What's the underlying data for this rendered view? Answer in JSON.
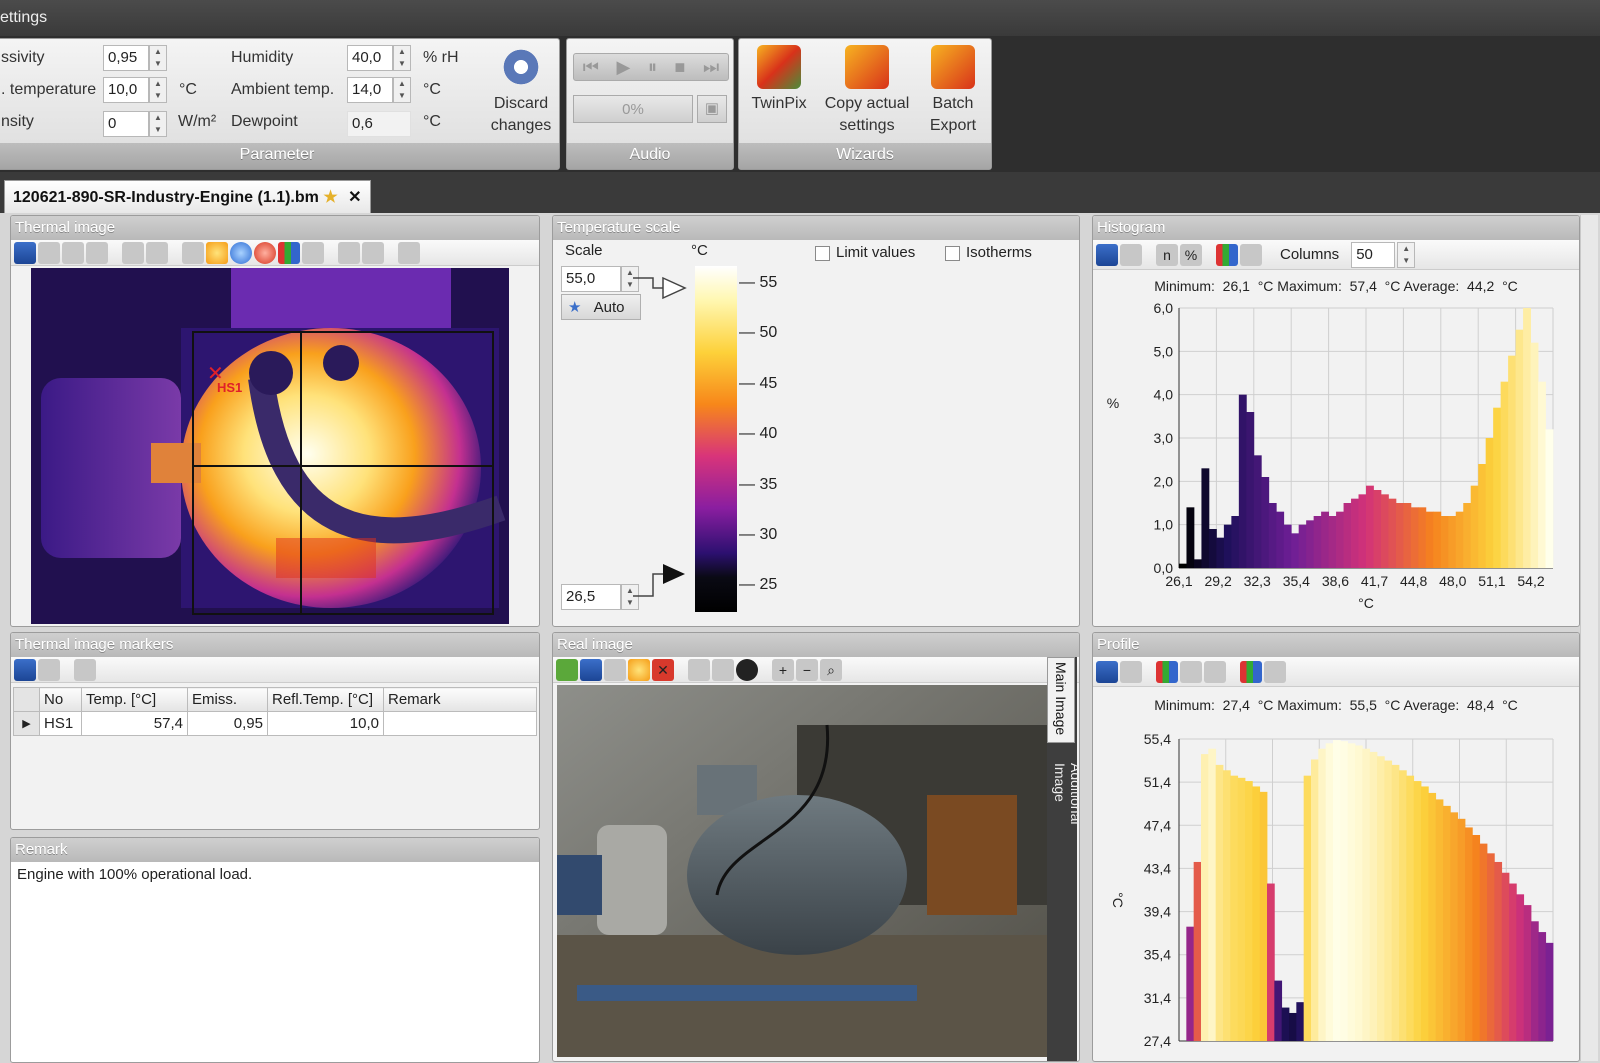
{
  "window": {
    "title": "ettings"
  },
  "ribbon": {
    "parameter": {
      "title": "Parameter",
      "rows": [
        {
          "label": "ssivity",
          "value": "0,95",
          "unit": "",
          "label2": "Humidity",
          "value2": "40,0",
          "unit2": "% rH"
        },
        {
          "label": ". temperature",
          "value": "10,0",
          "unit": "°C",
          "label2": "Ambient temp.",
          "value2": "14,0",
          "unit2": "°C"
        },
        {
          "label": "nsity",
          "value": "0",
          "unit": "W/m²",
          "label2": "Dewpoint",
          "value2": "0,6",
          "unit2": "°C"
        }
      ],
      "discard_line1": "Discard",
      "discard_line2": "changes"
    },
    "audio": {
      "title": "Audio",
      "progress_text": "0%",
      "progress": 0
    },
    "wizards": {
      "title": "Wizards",
      "twinpix": "TwinPix",
      "copy_line1": "Copy actual",
      "copy_line2": "settings",
      "batch_line1": "Batch",
      "batch_line2": "Export"
    }
  },
  "document_tab": {
    "label": "120621-890-SR-Industry-Engine (1.1).bm"
  },
  "thermal_image": {
    "title": "Thermal image",
    "marker_label": "HS1"
  },
  "temperature_scale": {
    "title": "Temperature scale",
    "scale_label": "Scale",
    "unit": "°C",
    "max_value": "55,0",
    "min_value": "26,5",
    "auto_label": "Auto",
    "limit_values_label": "Limit values",
    "isotherms_label": "Isotherms",
    "ticks": [
      "55",
      "50",
      "45",
      "40",
      "35",
      "30",
      "25"
    ]
  },
  "histogram": {
    "title": "Histogram",
    "columns_label": "Columns",
    "columns_value": "50",
    "stats": "Minimum:  26,1  °C Maximum:  57,4  °C Average:  44,2  °C"
  },
  "thermal_markers": {
    "title": "Thermal image markers",
    "columns": [
      "No",
      "Temp. [°C]",
      "Emiss.",
      "Refl.Temp. [°C]",
      "Remark"
    ],
    "rows": [
      [
        "HS1",
        "57,4",
        "0,95",
        "10,0",
        ""
      ]
    ]
  },
  "remark": {
    "title": "Remark",
    "text": "Engine with 100% operational load."
  },
  "real_image": {
    "title": "Real image",
    "tab_main": "Main Image",
    "tab_additional": "Additional Image"
  },
  "profile": {
    "title": "Profile",
    "stats": "Minimum:  27,4  °C Maximum:  55,5  °C Average:  48,4  °C"
  },
  "colors": {
    "accent": "#1c4595",
    "panel_title": "#b9b9b9",
    "marker_red": "#e0202a"
  },
  "chart_data": [
    {
      "type": "bar",
      "title": "",
      "xlabel": "°C",
      "ylabel": "%",
      "ylim": [
        0,
        6
      ],
      "xlim": [
        26.1,
        57.4
      ],
      "x_tick_labels": [
        "26,1",
        "29,2",
        "32,3",
        "35,4",
        "38,6",
        "41,7",
        "44,8",
        "48,0",
        "51,1",
        "54,2"
      ],
      "y_tick_labels": [
        "0,0",
        "1,0",
        "2,0",
        "3,0",
        "4,0",
        "5,0",
        "6,0"
      ],
      "grid": true,
      "values": [
        0.1,
        1.4,
        0.2,
        2.3,
        0.9,
        0.7,
        1.0,
        1.2,
        4.0,
        3.6,
        2.6,
        2.1,
        1.5,
        1.3,
        1.0,
        0.8,
        1.0,
        1.1,
        1.2,
        1.3,
        1.2,
        1.3,
        1.5,
        1.6,
        1.7,
        1.9,
        1.8,
        1.7,
        1.6,
        1.5,
        1.5,
        1.4,
        1.4,
        1.3,
        1.3,
        1.2,
        1.2,
        1.3,
        1.5,
        1.9,
        2.4,
        3.0,
        3.7,
        4.3,
        4.9,
        5.5,
        6.0,
        5.2,
        4.3,
        3.2
      ]
    },
    {
      "type": "area",
      "title": "",
      "xlabel": "",
      "ylabel": "°C",
      "ylim": [
        27.4,
        55.4
      ],
      "y_tick_labels": [
        "55,4",
        "51,4",
        "47,4",
        "43,4",
        "39,4",
        "35,4",
        "31,4",
        "27,4"
      ],
      "grid": true,
      "values": [
        27.4,
        38.0,
        44.0,
        54.0,
        54.5,
        53.0,
        52.5,
        52.0,
        51.8,
        51.5,
        51.0,
        50.5,
        42.0,
        33.0,
        30.5,
        30.0,
        31.0,
        52.0,
        53.5,
        54.5,
        55.0,
        55.3,
        55.2,
        55.0,
        54.8,
        54.5,
        54.2,
        53.8,
        53.4,
        53.0,
        52.5,
        52.0,
        51.5,
        51.0,
        50.4,
        49.8,
        49.2,
        48.6,
        48.0,
        47.2,
        46.5,
        45.7,
        44.8,
        44.0,
        43.0,
        42.0,
        41.0,
        40.0,
        38.5,
        37.5,
        36.5
      ]
    }
  ]
}
